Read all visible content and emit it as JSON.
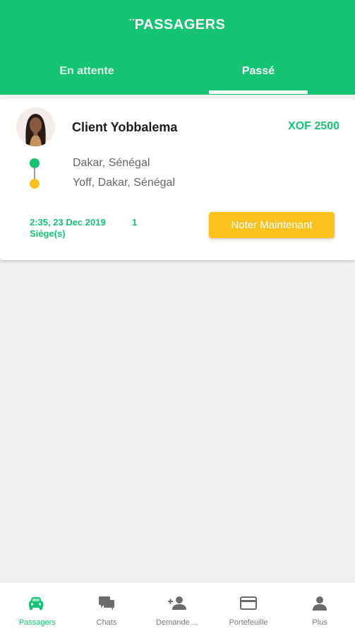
{
  "header": {
    "title": "¨PASSAGERS",
    "tabs": [
      {
        "label": "En attente"
      },
      {
        "label": "Passé"
      }
    ],
    "active_tab": "Passé"
  },
  "colors": {
    "primary": "#14c473",
    "accent": "#fbc21d",
    "background": "#f1f1f1"
  },
  "trip": {
    "avatar_icon": "client-avatar-photo",
    "client_name": "Client Yobbalema",
    "price": "XOF 2500",
    "origin": "Dakar, Sénégal",
    "destination": "Yoff, Dakar, Sénégal",
    "datetime": "2:35, 23 Dec 2019",
    "seats_label": "Siége(s)",
    "seats_count": "1",
    "rate_button": "Noter Maintenant"
  },
  "bottom_nav": {
    "items": [
      {
        "label": "¨Passagers",
        "icon": "car-icon",
        "active": true
      },
      {
        "label": "Chats",
        "icon": "chat-icon",
        "active": false
      },
      {
        "label": "Demande ...",
        "icon": "add-person-icon",
        "active": false
      },
      {
        "label": "Portefeuille",
        "icon": "credit-card-icon",
        "active": false
      },
      {
        "label": "Plus",
        "icon": "person-icon",
        "active": false
      }
    ]
  }
}
